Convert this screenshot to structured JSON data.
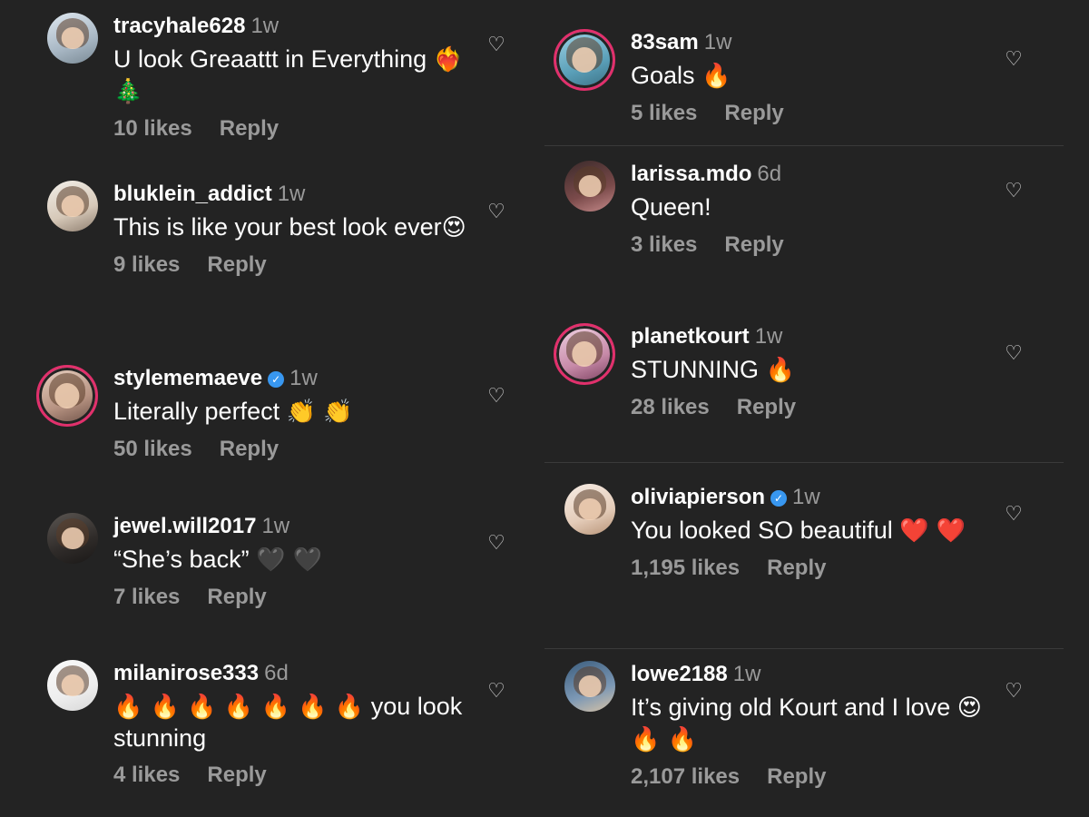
{
  "left_comments": [
    {
      "username": "tracyhale628",
      "verified": false,
      "time": "1w",
      "text": "U look Greaattt in Everything",
      "emoji": "❤‍🔥 🎄",
      "likes": "10 likes",
      "reply": "Reply"
    },
    {
      "username": "bluklein_addict",
      "verified": false,
      "time": "1w",
      "text": "This is like your best look ever",
      "emoji": "😍",
      "likes": "9 likes",
      "reply": "Reply"
    },
    {
      "username": "stylememaeve",
      "verified": true,
      "time": "1w",
      "text": "Literally perfect",
      "emoji": "👏 👏",
      "likes": "50 likes",
      "reply": "Reply"
    },
    {
      "username": "jewel.will2017",
      "verified": false,
      "time": "1w",
      "text": "“She’s back”",
      "emoji": "🖤 🖤",
      "likes": "7 likes",
      "reply": "Reply"
    },
    {
      "username": "milanirose333",
      "verified": false,
      "time": "6d",
      "text": "you look stunning",
      "emoji": "🔥 🔥 🔥 🔥 🔥 🔥 🔥",
      "likes": "4 likes",
      "reply": "Reply"
    }
  ],
  "right_comments": [
    {
      "username": "83sam",
      "verified": false,
      "time": "1w",
      "text": "Goals",
      "emoji": "🔥",
      "likes": "5 likes",
      "reply": "Reply"
    },
    {
      "username": "larissa.mdo",
      "verified": false,
      "time": "6d",
      "text": "Queen!",
      "emoji": "",
      "likes": "3 likes",
      "reply": "Reply"
    },
    {
      "username": "planetkourt",
      "verified": false,
      "time": "1w",
      "text": "STUNNING",
      "emoji": "🔥",
      "likes": "28 likes",
      "reply": "Reply"
    },
    {
      "username": "oliviapierson",
      "verified": true,
      "time": "1w",
      "text": "You looked SO beautiful",
      "emoji": "❤️ ❤️",
      "likes": "1,195 likes",
      "reply": "Reply"
    },
    {
      "username": "lowe2188",
      "verified": false,
      "time": "1w",
      "text": "It’s giving old Kourt and I love",
      "emoji": "😍 🔥 🔥",
      "likes": "2,107 likes",
      "reply": "Reply"
    }
  ],
  "icons": {
    "like": "heart-outline-icon",
    "verified": "verified-badge-icon"
  },
  "colors": {
    "background": "#232323",
    "username": "#ffffff",
    "secondary_text": "#9a9a9a",
    "verified_badge": "#3897f0",
    "story_ring": "#e1306c"
  }
}
